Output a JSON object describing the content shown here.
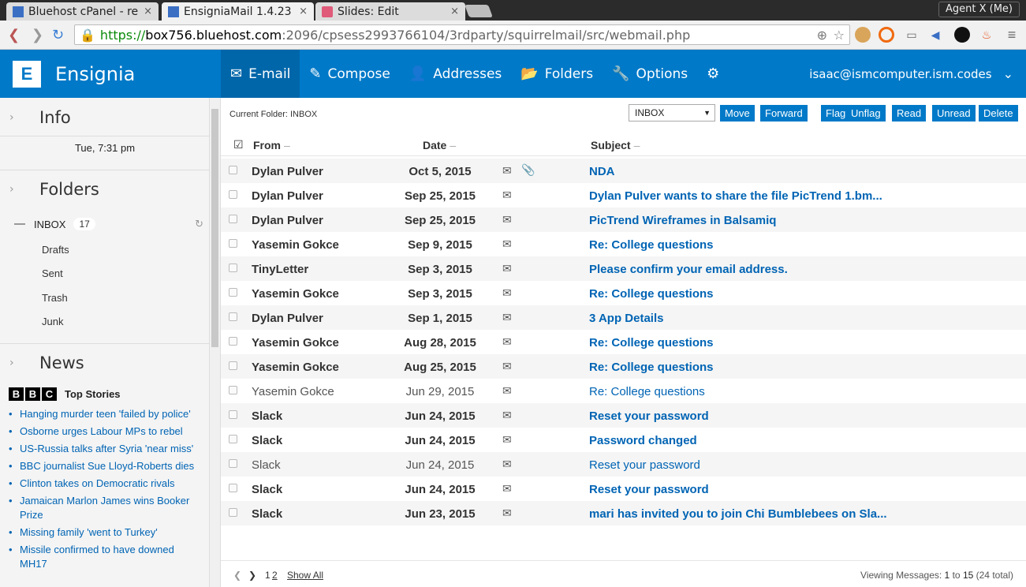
{
  "browser": {
    "tabs": [
      {
        "title": "Bluehost cPanel - rel",
        "close": "×"
      },
      {
        "title": "EnsigniaMail 1.4.23 |",
        "close": "×"
      },
      {
        "title": "Slides: Edit",
        "close": "×"
      }
    ],
    "profile": "Agent X (Me)",
    "url_scheme": "https://",
    "url_host": "box756.bluehost.com",
    "url_path": ":2096/cpsess2993766104/3rdparty/squirrelmail/src/webmail.php"
  },
  "app": {
    "brand": "Ensignia",
    "nav": [
      {
        "label": "E-mail",
        "icon": "envelope-icon"
      },
      {
        "label": "Compose",
        "icon": "edit-icon"
      },
      {
        "label": "Addresses",
        "icon": "user-icon"
      },
      {
        "label": "Folders",
        "icon": "folder-icon"
      },
      {
        "label": "Options",
        "icon": "wrench-icon"
      }
    ],
    "user": "isaac@ismcomputer.ism.codes"
  },
  "sidebar": {
    "info_title": "Info",
    "clock": "Tue, 7:31 pm",
    "folders_title": "Folders",
    "inbox": {
      "label": "INBOX",
      "count": "17"
    },
    "folders": [
      "Drafts",
      "Sent",
      "Trash",
      "Junk"
    ],
    "news_title": "News",
    "news_source": "Top Stories",
    "news": [
      "Hanging murder teen 'failed by police'",
      "Osborne urges Labour MPs to rebel",
      "US-Russia talks after Syria 'near miss'",
      "BBC journalist Sue Lloyd-Roberts dies",
      "Clinton takes on Democratic rivals",
      "Jamaican Marlon James wins Booker Prize",
      "Missing family 'went to Turkey'",
      "Missile confirmed to have downed MH17"
    ]
  },
  "main": {
    "current_folder_label": "Current Folder:",
    "current_folder": "INBOX",
    "folder_select": "INBOX",
    "actions": [
      "Move",
      "Forward",
      "Flag",
      "Unflag",
      "Read",
      "Unread",
      "Delete"
    ],
    "columns": {
      "from": "From",
      "date": "Date",
      "subject": "Subject"
    },
    "messages": [
      {
        "from": "Dylan Pulver",
        "date": "Oct 5, 2015",
        "subject": "NDA",
        "status": "read-bold",
        "attachment": true
      },
      {
        "from": "Dylan Pulver",
        "date": "Sep 25, 2015",
        "subject": "Dylan Pulver wants to share the file PicTrend 1.bm...",
        "status": "unread"
      },
      {
        "from": "Dylan Pulver",
        "date": "Sep 25, 2015",
        "subject": "PicTrend Wireframes in Balsamiq",
        "status": "unread"
      },
      {
        "from": "Yasemin Gokce",
        "date": "Sep 9, 2015",
        "subject": "Re: College questions",
        "status": "unread"
      },
      {
        "from": "TinyLetter",
        "date": "Sep 3, 2015",
        "subject": "Please confirm your email address.",
        "status": "unread"
      },
      {
        "from": "Yasemin Gokce",
        "date": "Sep 3, 2015",
        "subject": "Re: College questions",
        "status": "unread"
      },
      {
        "from": "Dylan Pulver",
        "date": "Sep 1, 2015",
        "subject": "3 App Details",
        "status": "unread"
      },
      {
        "from": "Yasemin Gokce",
        "date": "Aug 28, 2015",
        "subject": "Re: College questions",
        "status": "unread"
      },
      {
        "from": "Yasemin Gokce",
        "date": "Aug 25, 2015",
        "subject": "Re: College questions",
        "status": "unread"
      },
      {
        "from": "Yasemin Gokce",
        "date": "Jun 29, 2015",
        "subject": "Re: College questions",
        "status": "read"
      },
      {
        "from": "Slack",
        "date": "Jun 24, 2015",
        "subject": "Reset your password",
        "status": "unread"
      },
      {
        "from": "Slack",
        "date": "Jun 24, 2015",
        "subject": "Password changed",
        "status": "unread"
      },
      {
        "from": "Slack",
        "date": "Jun 24, 2015",
        "subject": "Reset your password",
        "status": "read"
      },
      {
        "from": "Slack",
        "date": "Jun 24, 2015",
        "subject": "Reset your password",
        "status": "unread"
      },
      {
        "from": "Slack",
        "date": "Jun 23, 2015",
        "subject": "mari has invited you to join Chi Bumblebees on Sla...",
        "status": "unread"
      }
    ],
    "pager": {
      "pages": [
        "1",
        "2"
      ],
      "show_all": "Show All",
      "viewing_label": "Viewing Messages:",
      "from": "1",
      "to_word": "to",
      "to": "15",
      "total": "(24 total)"
    }
  }
}
